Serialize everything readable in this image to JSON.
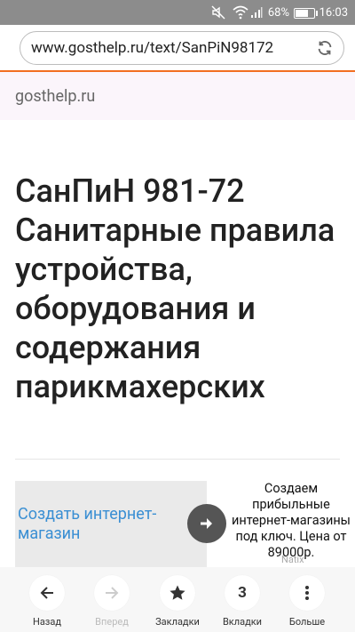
{
  "status_bar": {
    "battery_percent": "68%",
    "battery_level": 0.68,
    "time": "16:03",
    "icons": [
      "mute-icon",
      "wifi-icon",
      "signal-icon",
      "battery-icon"
    ]
  },
  "url_bar": {
    "url": "www.gosthelp.ru/text/SanPiN98172",
    "accent_color": "#f26f21"
  },
  "site": {
    "name": "gosthelp.ru"
  },
  "article": {
    "title": "СанПиН 981-72 Санитарные правила устройства, оборудования и содержания парикмахерских"
  },
  "ad": {
    "left_text": "Создать интернет-магазин",
    "right_text": "Создаем прибыльные интернет-магазины под ключ. Цена от 89000р.",
    "brand": "Natix",
    "link_color": "#3a8fd3"
  },
  "bottom_nav": {
    "back_label": "Назад",
    "forward_label": "Вперед",
    "bookmarks_label": "Закладки",
    "tabs_label": "Вкладки",
    "tabs_count": "3",
    "more_label": "Больше"
  }
}
